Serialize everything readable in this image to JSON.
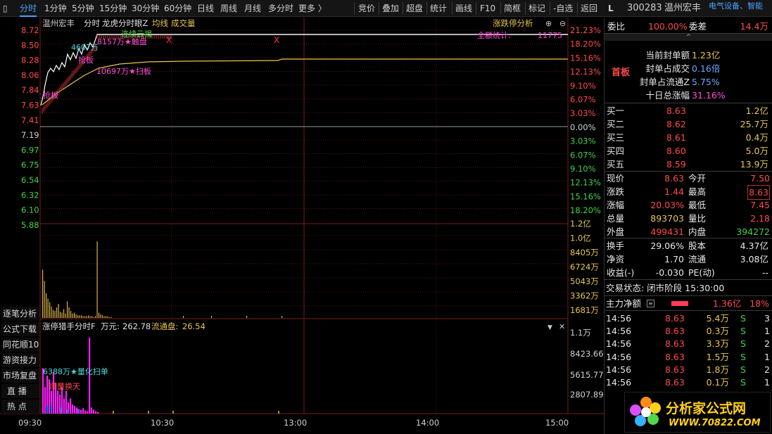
{
  "topbar": {
    "left_tabs": [
      "分时",
      "1分钟",
      "5分钟",
      "15分钟",
      "30分钟",
      "60分钟",
      "日线",
      "周线",
      "月线",
      "多分时",
      "更多 〉"
    ],
    "right_tools": [
      "竞价",
      "叠加",
      "超盘",
      "统计",
      "画线",
      "F10",
      "简框",
      "标记",
      "-自选",
      "返回"
    ],
    "stock_flag": "L",
    "stock_code": "300283",
    "stock_name": "温州宏丰",
    "stock_concept": "电气设备、智能"
  },
  "chart_header": {
    "name": "温州宏丰",
    "mode": "分时",
    "indicator": "龙虎分时眼Z",
    "avg_label": "均线",
    "vol_label": "成交量",
    "right_title": "涨跌停分析"
  },
  "left_axis_price": [
    "8.72",
    "8.50",
    "8.28",
    "8.06",
    "7.84",
    "7.63",
    "7.41",
    "7.19",
    "6.97",
    "6.75",
    "6.54",
    "6.32",
    "6.10",
    "5.88"
  ],
  "right_axis_pct": [
    "21.23%",
    "18.20%",
    "15.16%",
    "12.13%",
    "9.10%",
    "6.07%",
    "3.03%",
    "0.00%",
    "3.03%",
    "6.07%",
    "9.10%",
    "12.13%",
    "15.16%",
    "18.20%"
  ],
  "right_axis_vol": [
    "1.2亿",
    "1.0亿",
    "8405万",
    "6724万",
    "5043万",
    "3362万",
    "1681万"
  ],
  "annotations": {
    "lianxu": "连续云揭",
    "val_8157": "8157万★触盘",
    "val_4607": "4607万",
    "val_10697": "10697万★扫板",
    "qiangban": "抢板",
    "qiangban2": "抢板",
    "quanlian": "全额统计:",
    "val_11775": "11775",
    "x_mark": "X"
  },
  "sub_panel": {
    "title": "涨停猎手分时F",
    "unit": "万元:",
    "val1": "262.78",
    "val2_label": "流通盘:",
    "val2": "26.54",
    "axis": [
      "1.1万",
      "8423.66",
      "5615.77",
      "2807.89"
    ],
    "ann1": "6388万★量化扫单",
    "ann2": "爆量换天"
  },
  "left_buttons": [
    "逐笔分析",
    "公式下载",
    "同花顺10",
    "游资接力",
    "市场复盘",
    "直  播",
    "热  点"
  ],
  "time_axis": [
    "09:30",
    "10:30",
    "13:00",
    "14:00",
    "15:00"
  ],
  "right_panel": {
    "weibi_label": "委比",
    "weibi": "100.00%",
    "weicha_label": "委差",
    "weicha": "14.4万",
    "shoubang": "首板",
    "fengdan_rows": [
      {
        "label": "当前封单额",
        "value": "1.23亿"
      },
      {
        "label": "封单占成交",
        "value": "0.16倍"
      },
      {
        "label": "封单占流通Z",
        "value": "5.75%"
      },
      {
        "label": "十日总涨幅",
        "value": "31.16%"
      }
    ],
    "buy_rows": [
      {
        "label": "买一",
        "price": "8.63",
        "vol": "1.2亿"
      },
      {
        "label": "买二",
        "price": "8.62",
        "vol": "25.7万"
      },
      {
        "label": "买三",
        "price": "8.61",
        "vol": "0.4万"
      },
      {
        "label": "买四",
        "price": "8.60",
        "vol": "5.0万"
      },
      {
        "label": "买五",
        "price": "8.59",
        "vol": "13.9万"
      }
    ],
    "quote_rows": [
      {
        "l1": "现价",
        "v1": "8.63",
        "l2": "今开",
        "v2": "7.50"
      },
      {
        "l1": "涨跌",
        "v1": "1.44",
        "l2": "最高",
        "v2": "8.63"
      },
      {
        "l1": "涨幅",
        "v1": "20.03%",
        "l2": "最低",
        "v2": "7.45"
      },
      {
        "l1": "总量",
        "v1": "893703",
        "l2": "量比",
        "v2": "2.18"
      },
      {
        "l1": "外盘",
        "v1": "499431",
        "l2": "内盘",
        "v2": "394272"
      }
    ],
    "stat_rows": [
      {
        "l1": "换手",
        "v1": "29.06%",
        "l2": "股本",
        "v2": "4.37亿"
      },
      {
        "l1": "净资",
        "v1": "1.70",
        "l2": "流通",
        "v2": "3.08亿"
      },
      {
        "l1": "收益(-)",
        "v1": "-0.030",
        "l2": "PE(动)",
        "v2": "--"
      }
    ],
    "trade_status": "交易状态: 闭市阶段 15:30:00",
    "main_flow_label": "主力净额",
    "main_flow": "1.36亿",
    "main_flow_pct": "18%",
    "ticks": [
      {
        "t": "14:56",
        "p": "8.63",
        "v": "5.4万",
        "s": "S",
        "n": "3"
      },
      {
        "t": "14:56",
        "p": "8.63",
        "v": "0.3万",
        "s": "S",
        "n": "1"
      },
      {
        "t": "14:56",
        "p": "8.63",
        "v": "3.3万",
        "s": "S",
        "n": "2"
      },
      {
        "t": "14:56",
        "p": "8.63",
        "v": "1.5万",
        "s": "S",
        "n": "1"
      },
      {
        "t": "14:56",
        "p": "8.63",
        "v": "1.8万",
        "s": "S",
        "n": "2"
      },
      {
        "t": "14:56",
        "p": "8.63",
        "v": "0.1万",
        "s": "S",
        "n": "1"
      }
    ]
  },
  "logo": {
    "title": "分析家公式网",
    "url": "WWW.70822.COM"
  }
}
